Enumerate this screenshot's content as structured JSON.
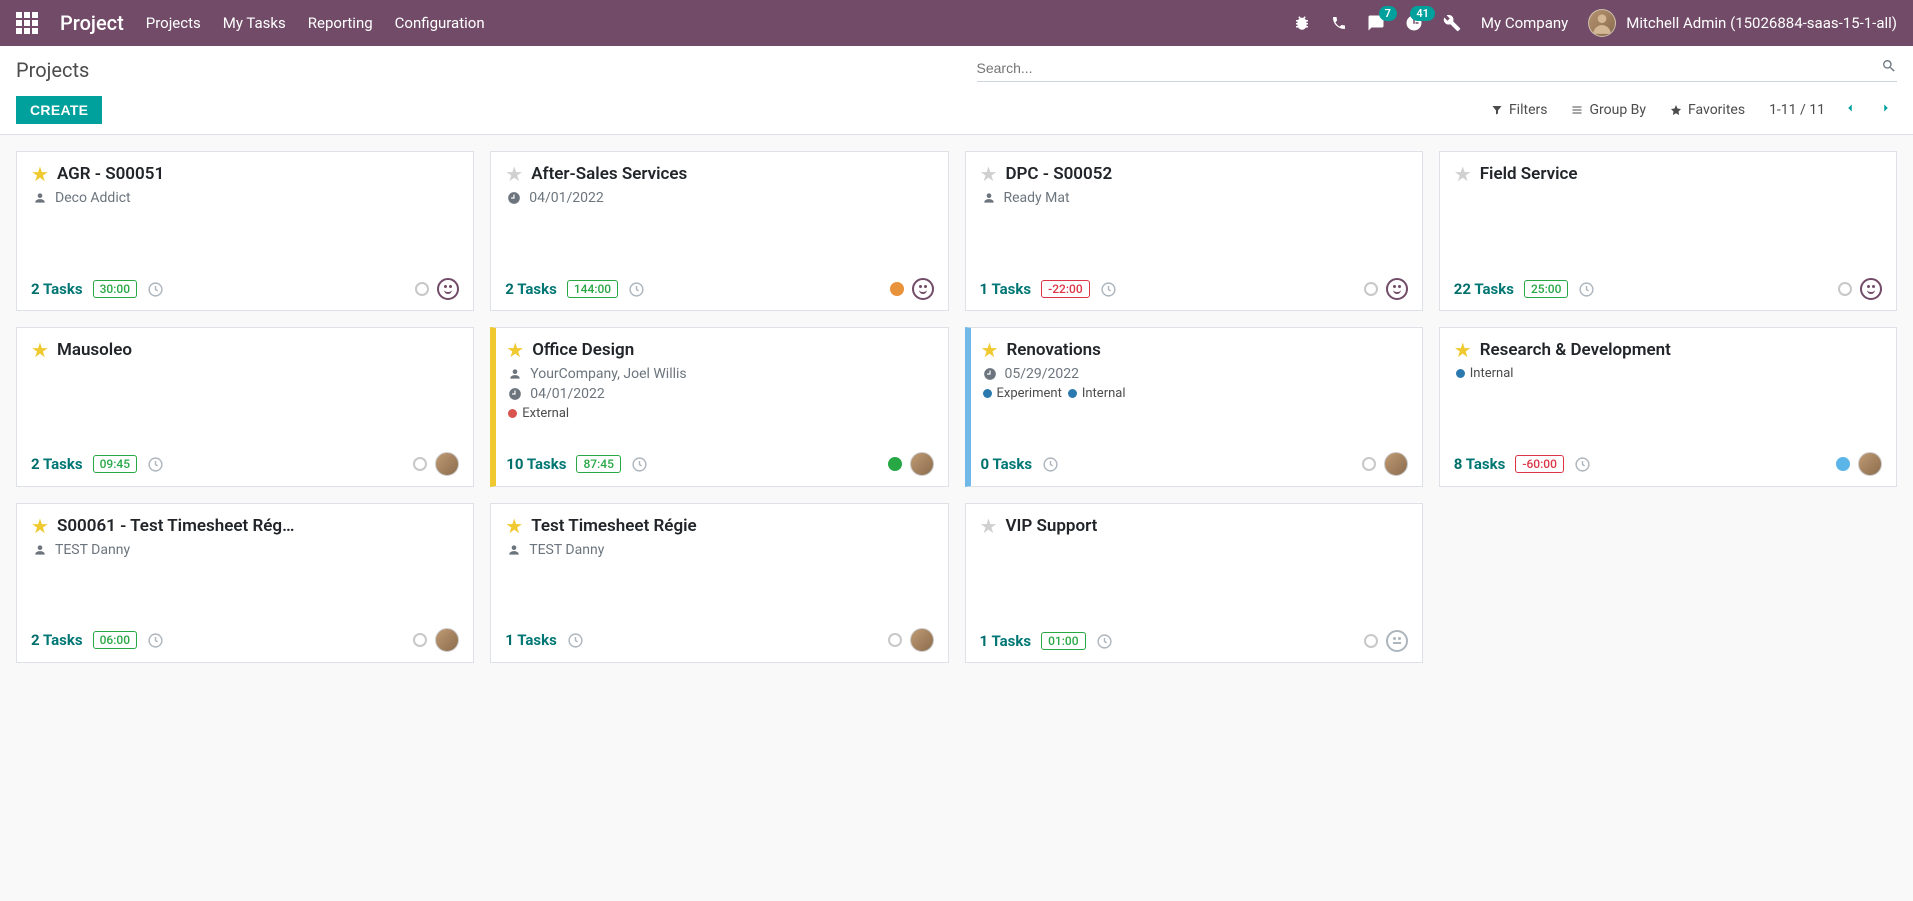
{
  "nav": {
    "brand": "Project",
    "links": [
      "Projects",
      "My Tasks",
      "Reporting",
      "Configuration"
    ],
    "msg_badge": "7",
    "activity_badge": "41",
    "company": "My Company",
    "user": "Mitchell Admin (15026884-saas-15-1-all)"
  },
  "cp": {
    "breadcrumb": "Projects",
    "search_placeholder": "Search...",
    "create_label": "CREATE",
    "filters_label": "Filters",
    "groupby_label": "Group By",
    "favorites_label": "Favorites",
    "pager": "1-11 / 11"
  },
  "tag_colors": {
    "external": "#d9534f",
    "experiment": "#2a7ab0",
    "internal": "#2a7ab0"
  },
  "cards": [
    {
      "title": "AGR - S00051",
      "fav": true,
      "bar": "",
      "partner": "Deco Addict",
      "date": "",
      "tags": [],
      "tasks_count": "2",
      "tasks_label": "Tasks",
      "hours": "30:00",
      "hours_neg": false,
      "status": "",
      "avatar": false,
      "smiley": "normal"
    },
    {
      "title": "After-Sales Services",
      "fav": false,
      "bar": "",
      "partner": "",
      "date": "04/01/2022",
      "tags": [],
      "tasks_count": "2",
      "tasks_label": "Tasks",
      "hours": "144:00",
      "hours_neg": false,
      "status": "orange",
      "avatar": false,
      "smiley": "normal"
    },
    {
      "title": "DPC - S00052",
      "fav": false,
      "bar": "",
      "partner": "Ready Mat",
      "date": "",
      "tags": [],
      "tasks_count": "1",
      "tasks_label": "Tasks",
      "hours": "-22:00",
      "hours_neg": true,
      "status": "",
      "avatar": false,
      "smiley": "normal"
    },
    {
      "title": "Field Service",
      "fav": false,
      "bar": "",
      "partner": "",
      "date": "",
      "tags": [],
      "tasks_count": "22",
      "tasks_label": "Tasks",
      "hours": "25:00",
      "hours_neg": false,
      "status": "",
      "avatar": false,
      "smiley": "normal"
    },
    {
      "title": "Mausoleo",
      "fav": true,
      "bar": "",
      "partner": "",
      "date": "",
      "tags": [],
      "tasks_count": "2",
      "tasks_label": "Tasks",
      "hours": "09:45",
      "hours_neg": false,
      "status": "",
      "avatar": true,
      "smiley": ""
    },
    {
      "title": "Office Design",
      "fav": true,
      "bar": "yellow",
      "partner": "YourCompany, Joel Willis",
      "date": "04/01/2022",
      "tags": [
        {
          "label": "External",
          "color": "external"
        }
      ],
      "tasks_count": "10",
      "tasks_label": "Tasks",
      "hours": "87:45",
      "hours_neg": false,
      "status": "green",
      "avatar": true,
      "smiley": ""
    },
    {
      "title": "Renovations",
      "fav": true,
      "bar": "blue",
      "partner": "",
      "date": "05/29/2022",
      "tags": [
        {
          "label": "Experiment",
          "color": "experiment"
        },
        {
          "label": "Internal",
          "color": "internal"
        }
      ],
      "tasks_count": "0",
      "tasks_label": "Tasks",
      "hours": "",
      "hours_neg": false,
      "status": "",
      "avatar": true,
      "smiley": ""
    },
    {
      "title": "Research & Development",
      "fav": true,
      "bar": "",
      "partner": "",
      "date": "",
      "tags": [
        {
          "label": "Internal",
          "color": "internal"
        }
      ],
      "tasks_count": "8",
      "tasks_label": "Tasks",
      "hours": "-60:00",
      "hours_neg": true,
      "status": "blue",
      "avatar": true,
      "smiley": ""
    },
    {
      "title": "S00061 - Test Timesheet Rég…",
      "fav": true,
      "bar": "",
      "partner": "TEST Danny",
      "date": "",
      "tags": [],
      "tasks_count": "2",
      "tasks_label": "Tasks",
      "hours": "06:00",
      "hours_neg": false,
      "status": "",
      "avatar": true,
      "smiley": ""
    },
    {
      "title": "Test Timesheet Régie",
      "fav": true,
      "bar": "",
      "partner": "TEST Danny",
      "date": "",
      "tags": [],
      "tasks_count": "1",
      "tasks_label": "Tasks",
      "hours": "",
      "hours_neg": false,
      "status": "",
      "avatar": true,
      "smiley": ""
    },
    {
      "title": "VIP Support",
      "fav": false,
      "bar": "",
      "partner": "",
      "date": "",
      "tags": [],
      "tasks_count": "1",
      "tasks_label": "Tasks",
      "hours": "01:00",
      "hours_neg": false,
      "status": "",
      "avatar": false,
      "smiley": "gray"
    }
  ]
}
